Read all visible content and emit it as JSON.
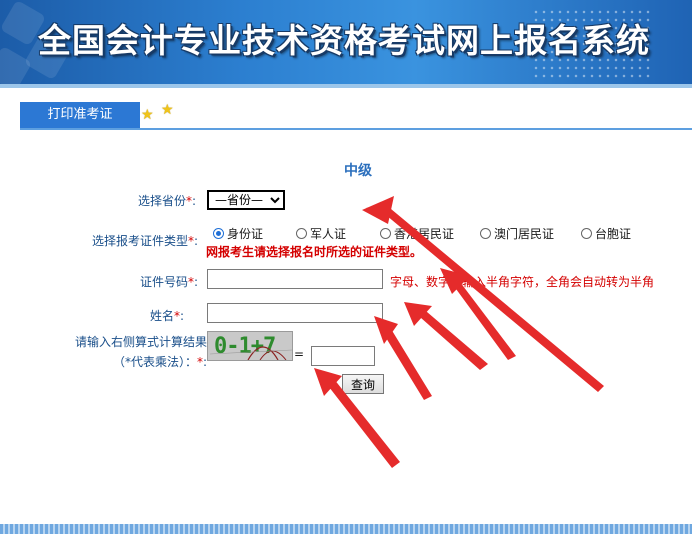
{
  "banner": {
    "title": "全国会计专业技术资格考试网上报名系统"
  },
  "tab": {
    "label": "打印准考证"
  },
  "form": {
    "level": "中级",
    "province_label": "选择省份",
    "province_selected": "—省份—",
    "id_type_label": "选择报考证件类型",
    "id_types": [
      "身份证",
      "军人证",
      "香港居民证",
      "澳门居民证",
      "台胞证"
    ],
    "id_type_selected": "身份证",
    "id_type_warning": "网报考生请选择报名时所选的证件类型。",
    "id_number_label": "证件号码",
    "id_number_hint": "字母、数字请输入半角字符，全角会自动转为半角",
    "name_label": "姓名",
    "captcha_label_line1": "请输入右侧算式计算结果",
    "captcha_label_line2": "（*代表乘法）：",
    "captcha_text": "0-1+7",
    "equals": "=",
    "submit_label": "查询",
    "required_mark": "*",
    "colon": ":"
  },
  "colors": {
    "accent": "#2c78d4",
    "required": "#d40000",
    "arrow": "#e52b2b"
  },
  "icons": [
    "star-icon",
    "star-icon"
  ]
}
